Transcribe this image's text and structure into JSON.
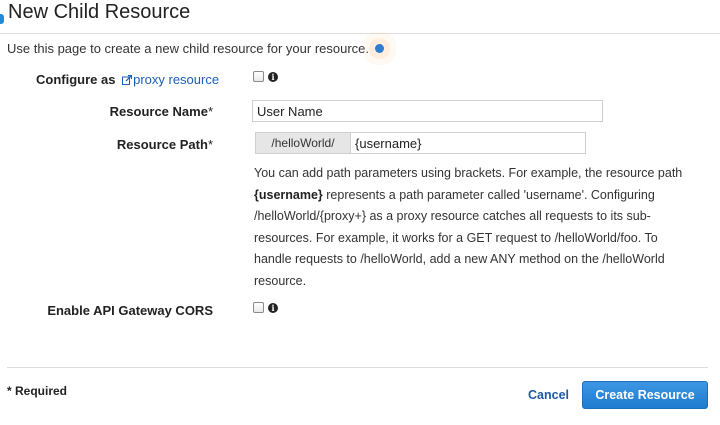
{
  "page": {
    "title": "New Child Resource",
    "intro": "Use this page to create a new child resource for your resource."
  },
  "form": {
    "configure_label_prefix": "Configure as",
    "proxy_link_text": "proxy resource",
    "resource_name_label": "Resource Name",
    "resource_name_value": "User Name",
    "resource_path_label": "Resource Path",
    "resource_path_prefix": "/helloWorld/",
    "resource_path_value": "{username}",
    "required_marker": "*",
    "help": {
      "part1": "You can add path parameters using brackets. For example, the resource path ",
      "bold": "{username}",
      "part2": " represents a path parameter called 'username'. Configuring /helloWorld/{proxy+} as a proxy resource catches all requests to its sub-resources. For example, it works for a GET request to /helloWorld/foo. To handle requests to /helloWorld, add a new ANY method on the /helloWorld resource."
    },
    "cors_label": "Enable API Gateway CORS",
    "proxy_checked": false,
    "cors_checked": false
  },
  "footer": {
    "required_note": "* Required",
    "cancel_label": "Cancel",
    "create_label": "Create Resource"
  },
  "icons": {
    "info": "info-icon",
    "external_link": "external-link-icon"
  },
  "colors": {
    "accent": "#1f7bd0",
    "link": "#1a5fb4",
    "info_dot": "#2e7bcf"
  }
}
